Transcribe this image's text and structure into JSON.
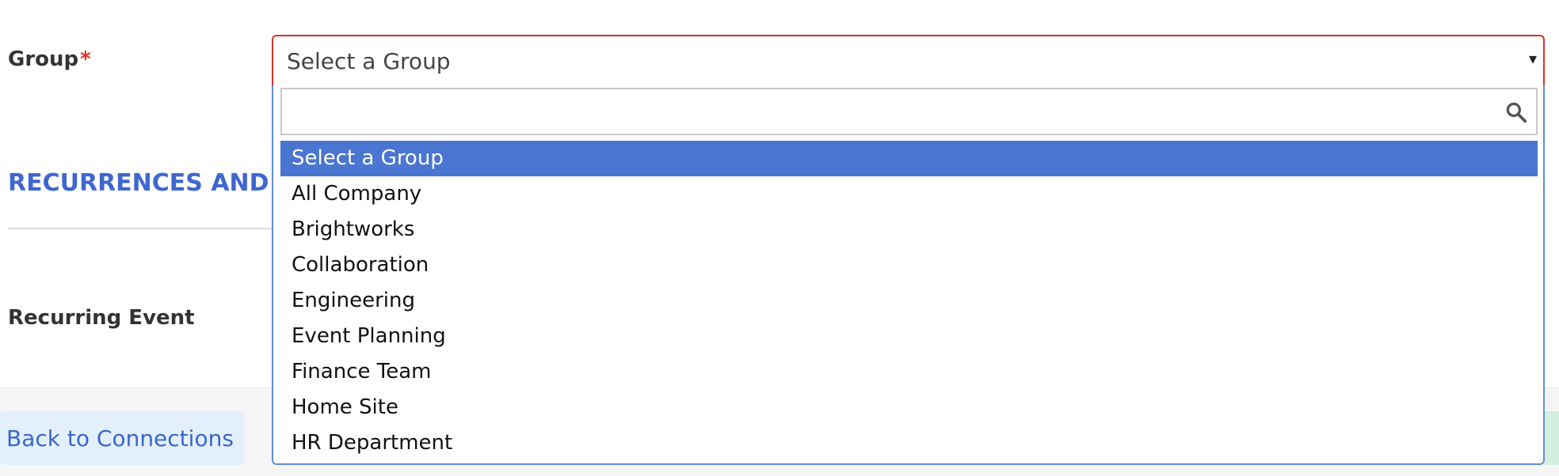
{
  "form": {
    "group_label": "Group",
    "required_marker": "*",
    "section_title": "RECURRENCES AND R",
    "recurring_label": "Recurring Event"
  },
  "select": {
    "value": "Select a Group",
    "arrow": "▾",
    "search": {
      "value": "",
      "placeholder": ""
    },
    "options": [
      "Select a Group",
      "All Company",
      "Brightworks",
      "Collaboration",
      "Engineering",
      "Event Planning",
      "Finance Team",
      "Home Site",
      "HR Department"
    ],
    "selected_index": 0
  },
  "footer": {
    "back_label": "Back to Connections"
  },
  "colors": {
    "accent": "#3f67cf",
    "required": "#e0322b",
    "highlight": "#4a75d1"
  }
}
